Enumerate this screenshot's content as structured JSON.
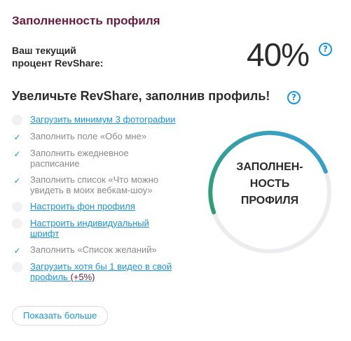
{
  "header": {
    "title": "Заполненность профиля"
  },
  "revshare": {
    "label_line1": "Ваш текущий",
    "label_line2": "процент RevShare:",
    "value": "40%",
    "help_icon": "question-circle-icon"
  },
  "section": {
    "title": "Увеличьте RevShare, заполнив профиль!",
    "help_icon": "question-circle-icon"
  },
  "tasks": [
    {
      "line1": "Загрузить минимум 3 фотографии",
      "line2": "",
      "done": false,
      "link": true
    },
    {
      "line1": "Заполнить поле «Обо мне»",
      "line2": "",
      "done": true,
      "link": false
    },
    {
      "line1": "Заполнить ежедневное",
      "line2": "расписание",
      "done": true,
      "link": false
    },
    {
      "line1": "Заполнить список «Что можно",
      "line2": "увидеть в моих вебкам-шоу»",
      "done": true,
      "link": false
    },
    {
      "line1": "Настроить фон профиля",
      "line2": "",
      "done": false,
      "link": true
    },
    {
      "line1": "Настроить индивидуальный",
      "line2": "шрифт",
      "done": false,
      "link": true
    },
    {
      "line1": "Заполнить «Список желаний»",
      "line2": "",
      "done": true,
      "link": false
    },
    {
      "line1": "Загрузить хотя бы 1 видео в свой",
      "line2": "профиль",
      "bonus": "(+5%)",
      "done": false,
      "link": true
    }
  ],
  "more_button": {
    "label": "Показать больше"
  },
  "gauge": {
    "line1": "ЗАПОЛНЕН-",
    "line2": "НОСТЬ",
    "line3": "ПРОФИЛЯ",
    "progress": 0.5,
    "colors": {
      "track": "#ececef",
      "start": "#2e9e6e",
      "end": "#3aa0d8"
    }
  },
  "colors": {
    "accent": "#1b95d9",
    "brand": "#6a1b3c",
    "text": "#2b2b2b",
    "muted": "#8a8a8a"
  }
}
